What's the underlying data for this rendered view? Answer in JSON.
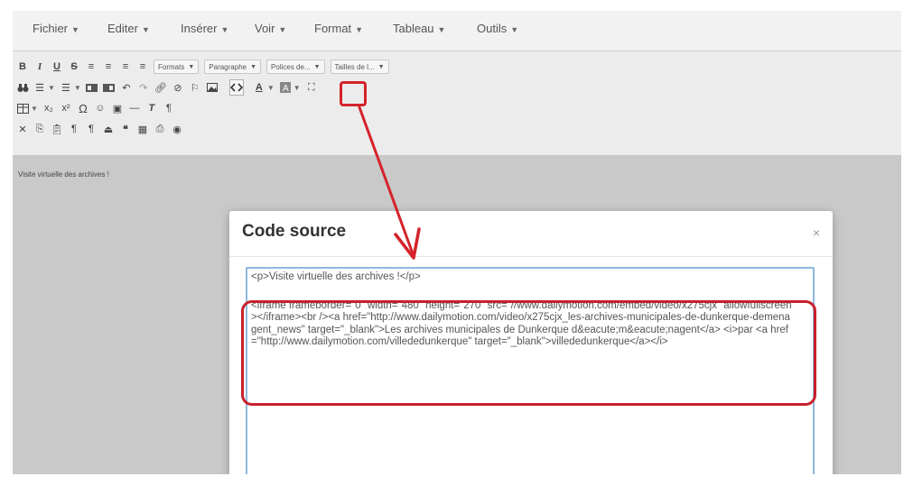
{
  "menubar": {
    "items": [
      {
        "label": "Fichier"
      },
      {
        "label": "Editer"
      },
      {
        "label": "Insérer"
      },
      {
        "label": "Voir"
      },
      {
        "label": "Format"
      },
      {
        "label": "Tableau"
      },
      {
        "label": "Outils"
      }
    ]
  },
  "toolbar": {
    "row1": {
      "bold": "B",
      "italic": "I",
      "underline": "U",
      "strikethrough": "S",
      "formats": "Formats",
      "paragraphe": "Paragraphe",
      "polices": "Polices de...",
      "tailles": "Tailles de l..."
    },
    "row4": {
      "pilcrow": "¶"
    }
  },
  "editor": {
    "content_text": "Visite virtuelle des archives !"
  },
  "modal": {
    "title": "Code source",
    "close": "×",
    "code_line1": "<p>Visite virtuelle des archives !</p>",
    "code_block": "<iframe frameborder=\"0\" width=\"480\" height=\"270\" src=\"//www.dailymotion.com/embed/video/x275cjx\" allowfullscreen></iframe><br /><a href=\"http://www.dailymotion.com/video/x275cjx_les-archives-municipales-de-dunkerque-demenagent_news\" target=\"_blank\">Les archives municipales de Dunkerque d&eacute;m&eacute;nagent</a> <i>par <a href=\"http://www.dailymotion.com/villededunkerque\" target=\"_blank\">villededunkerque</a></i>"
  },
  "colors": {
    "annotation_red": "#d4232b",
    "textarea_border": "#8db8dc"
  }
}
